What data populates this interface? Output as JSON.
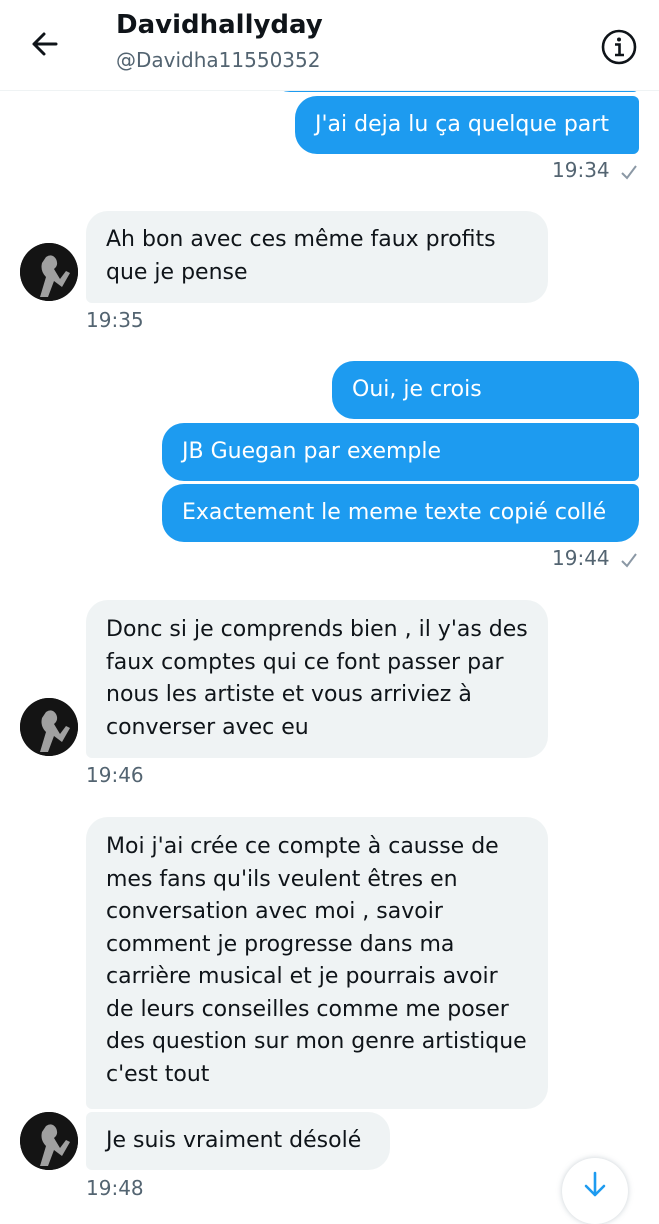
{
  "header": {
    "title": "Davidhallyday",
    "handle": "@Davidha11550352",
    "back_icon": "arrow-left-icon",
    "info_icon": "info-icon"
  },
  "colors": {
    "accent": "#1d9bf0",
    "received_bubble": "#eff3f4",
    "timestamp": "#536471"
  },
  "messages": {
    "m1": {
      "direction": "sent",
      "text": "J'ai deja lu ça quelque part"
    },
    "t1": "19:34",
    "m2": {
      "direction": "received",
      "text": "Ah bon avec ces même faux profits que je pense"
    },
    "t2": "19:35",
    "m3": {
      "direction": "sent",
      "text": "Oui, je crois"
    },
    "m4": {
      "direction": "sent",
      "text": "JB Guegan par exemple"
    },
    "m5": {
      "direction": "sent",
      "text": "Exactement le meme texte copié collé"
    },
    "t3": "19:44",
    "m6": {
      "direction": "received",
      "text": "Donc si je comprends bien , il y'as des faux comptes qui ce font passer par nous les artiste et vous arriviez à converser avec eu"
    },
    "t4": "19:46",
    "m7": {
      "direction": "received",
      "text": "Moi j'ai crée ce compte à causse de mes fans qu'ils veulent êtres en conversation avec moi , savoir comment je progresse dans ma carrière musical et je pourrais avoir de leurs conseilles comme me poser des question sur mon genre artistique c'est tout"
    },
    "m8": {
      "direction": "received",
      "text": "Je suis vraiment désolé"
    },
    "t5": "19:48"
  },
  "scroll_icon": "arrow-down-icon"
}
